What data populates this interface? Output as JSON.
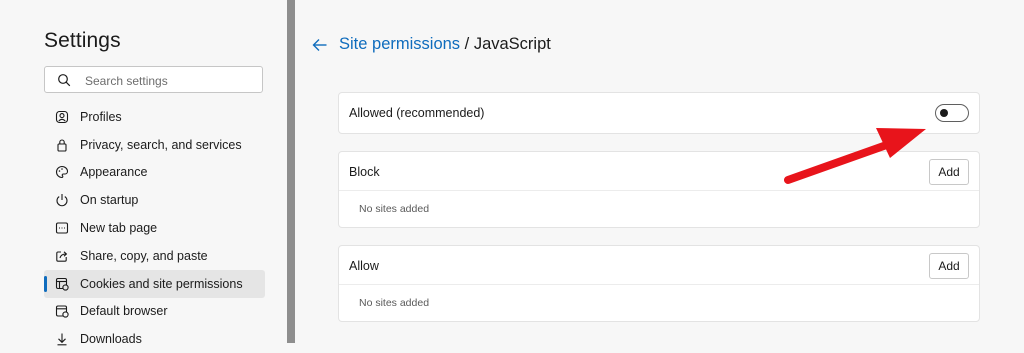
{
  "sidebar": {
    "title": "Settings",
    "search": {
      "placeholder": "Search settings",
      "value": ""
    },
    "items": [
      {
        "label": "Profiles",
        "icon": "profile-icon"
      },
      {
        "label": "Privacy, search, and services",
        "icon": "lock-icon"
      },
      {
        "label": "Appearance",
        "icon": "palette-icon"
      },
      {
        "label": "On startup",
        "icon": "power-icon"
      },
      {
        "label": "New tab page",
        "icon": "new-tab-icon"
      },
      {
        "label": "Share, copy, and paste",
        "icon": "share-icon"
      },
      {
        "label": "Cookies and site permissions",
        "icon": "cookie-permissions-icon",
        "active": true
      },
      {
        "label": "Default browser",
        "icon": "browser-icon"
      },
      {
        "label": "Downloads",
        "icon": "download-icon"
      }
    ]
  },
  "header": {
    "breadcrumb_parent": "Site permissions",
    "breadcrumb_separator": " / ",
    "breadcrumb_current": "JavaScript"
  },
  "allowed_toggle": {
    "label": "Allowed (recommended)",
    "on": false
  },
  "block_section": {
    "title": "Block",
    "add_label": "Add",
    "empty_text": "No sites added"
  },
  "allow_section": {
    "title": "Allow",
    "add_label": "Add",
    "empty_text": "No sites added"
  },
  "colors": {
    "accent": "#0f6cbd",
    "annotation_arrow": "#e8141b",
    "sidebar_bg": "#f7f7f7",
    "card_bg": "#ffffff"
  }
}
